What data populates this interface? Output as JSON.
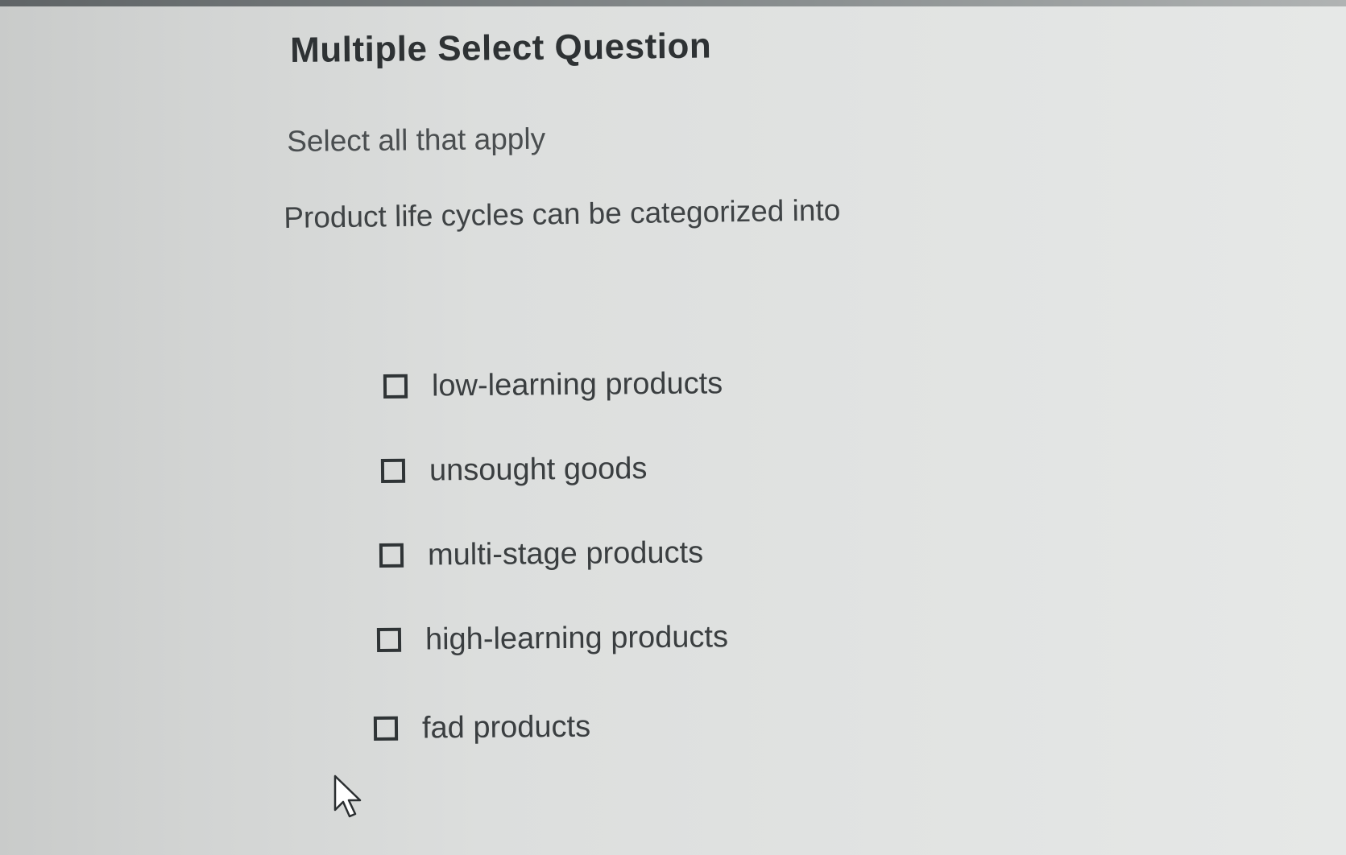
{
  "question": {
    "title": "Multiple Select Question",
    "instruction": "Select all that apply",
    "prompt": "Product life cycles can be categorized into"
  },
  "options": [
    {
      "label": "low-learning products",
      "checked": false
    },
    {
      "label": "unsought goods",
      "checked": false
    },
    {
      "label": "multi-stage products",
      "checked": false
    },
    {
      "label": "high-learning products",
      "checked": false
    },
    {
      "label": "fad products",
      "checked": false
    }
  ],
  "icons": {
    "checkbox": "checkbox-icon",
    "cursor": "mouse-pointer-icon"
  },
  "colors": {
    "text": "#3a3e40",
    "checkbox_border": "#2f3436",
    "background": "#dcdedd"
  }
}
